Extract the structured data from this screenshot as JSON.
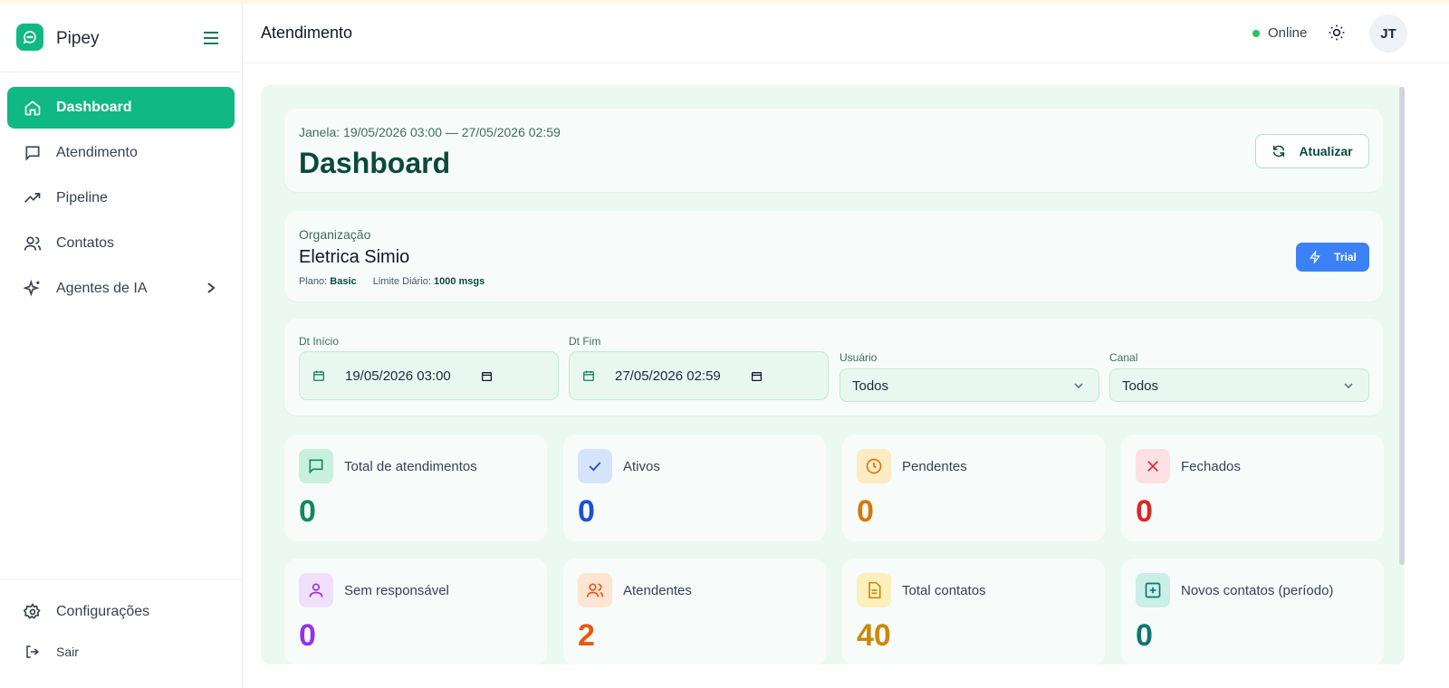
{
  "app": {
    "name": "Pipey"
  },
  "sidebar": {
    "items": [
      {
        "label": "Dashboard",
        "icon": "home-icon"
      },
      {
        "label": "Atendimento",
        "icon": "message-icon"
      },
      {
        "label": "Pipeline",
        "icon": "trending-up-icon"
      },
      {
        "label": "Contatos",
        "icon": "users-icon"
      },
      {
        "label": "Agentes de IA",
        "icon": "sparkles-icon"
      }
    ],
    "settings_label": "Configurações",
    "logout_label": "Sair"
  },
  "header": {
    "title": "Atendimento",
    "status": "Online",
    "avatar_initials": "JT"
  },
  "dashboard": {
    "window_text": "Janela: 19/05/2026 03:00 — 27/05/2026 02:59",
    "title": "Dashboard",
    "refresh_label": "Atualizar"
  },
  "organization": {
    "label": "Organização",
    "name": "Eletrica Simio",
    "plan_label": "Plano:",
    "plan_value": "Basic",
    "limit_label": "Limite Diário:",
    "limit_value": "1000 msgs",
    "badge": "Trial"
  },
  "filters": {
    "start_label": "Dt Início",
    "start_value": "19/05/2026 03:00",
    "end_label": "Dt Fim",
    "end_value": "27/05/2026 02:59",
    "user_label": "Usuário",
    "user_value": "Todos",
    "channel_label": "Canal",
    "channel_value": "Todos"
  },
  "stats": [
    {
      "label": "Total de atendimentos",
      "value": "0",
      "color": "#0f8a5f",
      "bg": "#c9f0de"
    },
    {
      "label": "Ativos",
      "value": "0",
      "color": "#1d4ed8",
      "bg": "#d6e4fb"
    },
    {
      "label": "Pendentes",
      "value": "0",
      "color": "#d97706",
      "bg": "#fdebc3"
    },
    {
      "label": "Fechados",
      "value": "0",
      "color": "#dc2626",
      "bg": "#fde0e3"
    },
    {
      "label": "Sem responsável",
      "value": "0",
      "color": "#9333ea",
      "bg": "#f0e0fb"
    },
    {
      "label": "Atendentes",
      "value": "2",
      "color": "#ea580c",
      "bg": "#fde4d3"
    },
    {
      "label": "Total contatos",
      "value": "40",
      "color": "#ca8a04",
      "bg": "#fbf0bd"
    },
    {
      "label": "Novos contatos (período)",
      "value": "0",
      "color": "#0f766e",
      "bg": "#c8efe8"
    }
  ]
}
